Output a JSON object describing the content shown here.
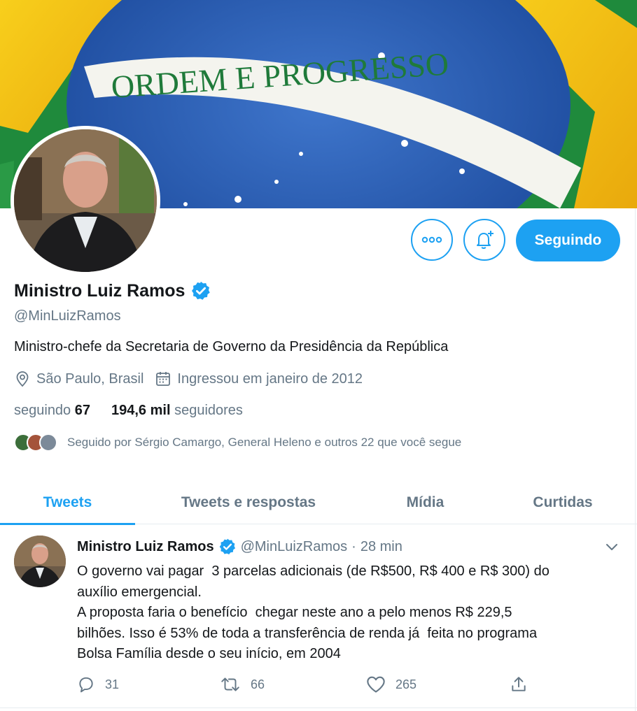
{
  "banner": {
    "motto": "ORDEM E PROGRESSO",
    "colors": {
      "green": "#1f8a3c",
      "yellow": "#f6c414",
      "blue": "#2a5fb8",
      "white": "#f4f4ee"
    }
  },
  "profile": {
    "name": "Ministro Luiz Ramos",
    "handle": "@MinLuizRamos",
    "bio": "Ministro-chefe da Secretaria de Governo da Presidência da República",
    "location": "São Paulo, Brasil",
    "joined": "Ingressou em janeiro de 2012",
    "following_label": "seguindo",
    "following_count": "67",
    "followers_count": "194,6 mil",
    "followers_label": "seguidores",
    "followed_by": "Seguido por Sérgio Camargo, General Heleno e outros 22 que você segue"
  },
  "buttons": {
    "more_icon": "more-icon",
    "bell_icon": "bell-plus-icon",
    "follow_label": "Seguindo"
  },
  "tabs": [
    {
      "label": "Tweets",
      "active": true
    },
    {
      "label": "Tweets e respostas",
      "active": false
    },
    {
      "label": "Mídia",
      "active": false
    },
    {
      "label": "Curtidas",
      "active": false
    }
  ],
  "tweet": {
    "name": "Ministro Luiz Ramos",
    "handle": "@MinLuizRamos",
    "separator": "·",
    "time": "28 min",
    "lines": [
      "O governo vai pagar  3 parcelas adicionais (de R$500, R$ 400 e R$ 300) do",
      "auxílio emergencial.",
      "A proposta faria o benefício  chegar neste ano a pelo menos R$ 229,5",
      "bilhões. Isso é 53% de toda a transferência de renda já  feita no programa",
      "Bolsa Família desde o seu início, em 2004"
    ],
    "replies": "31",
    "retweets": "66",
    "likes": "265"
  },
  "accent": "#1da1f2"
}
